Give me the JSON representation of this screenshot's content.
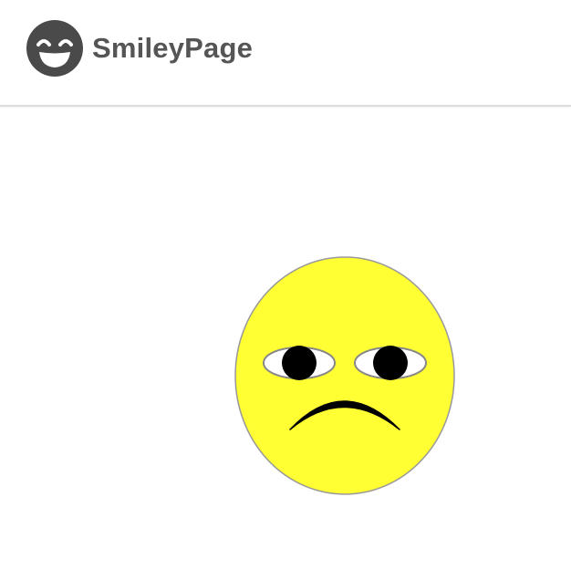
{
  "header": {
    "logo_icon": "grinning-face-icon",
    "brand_name": "SmileyPage"
  },
  "smiley": {
    "expression": "sad",
    "colors": {
      "face_fill": "#ffff33",
      "face_stroke": "#999999",
      "eye_white": "#ffffff",
      "eye_stroke": "#888888",
      "pupil": "#000000",
      "mouth": "#000000",
      "logo": "#4a4a4a"
    }
  }
}
